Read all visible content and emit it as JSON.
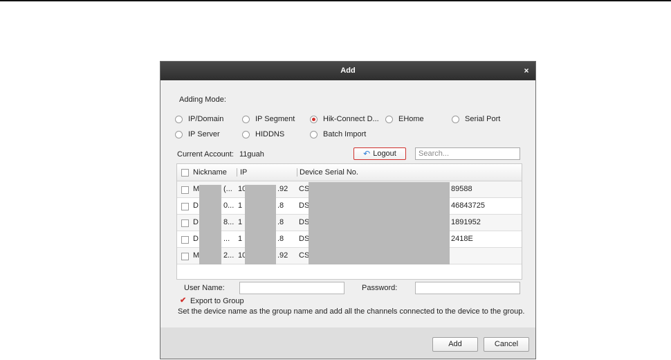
{
  "dialog": {
    "title": "Add",
    "close_glyph": "×",
    "adding_mode_label": "Adding Mode:",
    "modes": [
      {
        "label": "IP/Domain",
        "selected": false
      },
      {
        "label": "IP Segment",
        "selected": false
      },
      {
        "label": "Hik-Connect D...",
        "selected": true
      },
      {
        "label": "EHome",
        "selected": false
      },
      {
        "label": "Serial Port",
        "selected": false
      },
      {
        "label": "IP Server",
        "selected": false
      },
      {
        "label": "HIDDNS",
        "selected": false
      },
      {
        "label": "Batch Import",
        "selected": false
      }
    ],
    "current_account_label": "Current Account:",
    "current_account_value": "11guah",
    "logout_label": "Logout",
    "logout_icon": "undo-arrow-icon",
    "search_placeholder": "Search...",
    "table": {
      "headers": [
        "Nickname",
        "IP",
        "Device Serial No."
      ],
      "rows": [
        {
          "nickname": "M",
          "nickname_tail": "(...",
          "ip": "10",
          "ip_tail": ".92",
          "serial": "CS",
          "serial_tail": "89588"
        },
        {
          "nickname": "D",
          "nickname_tail": "0...",
          "ip": "1",
          "ip_tail": ".8",
          "serial": "DS",
          "serial_tail": "46843725"
        },
        {
          "nickname": "D",
          "nickname_tail": "8...",
          "ip": "1",
          "ip_tail": ".8",
          "serial": "DS",
          "serial_tail": "1891952"
        },
        {
          "nickname": "D",
          "nickname_tail": "...",
          "ip": "1",
          "ip_tail": ".8",
          "serial": "DS",
          "serial_tail": "2418E"
        },
        {
          "nickname": "M",
          "nickname_tail": "2...",
          "ip": "10",
          "ip_tail": ".92",
          "serial": "CS",
          "serial_tail": ""
        }
      ]
    },
    "user_name_label": "User Name:",
    "password_label": "Password:",
    "export_to_group_label": "Export to Group",
    "export_to_group_checked": true,
    "export_hint": "Set the device name as the group name and add all the channels connected to the device to the group.",
    "add_button": "Add",
    "cancel_button": "Cancel",
    "colors": {
      "accent": "#d0312d",
      "titlebar": "#3a3a3a",
      "background": "#efefef"
    }
  }
}
